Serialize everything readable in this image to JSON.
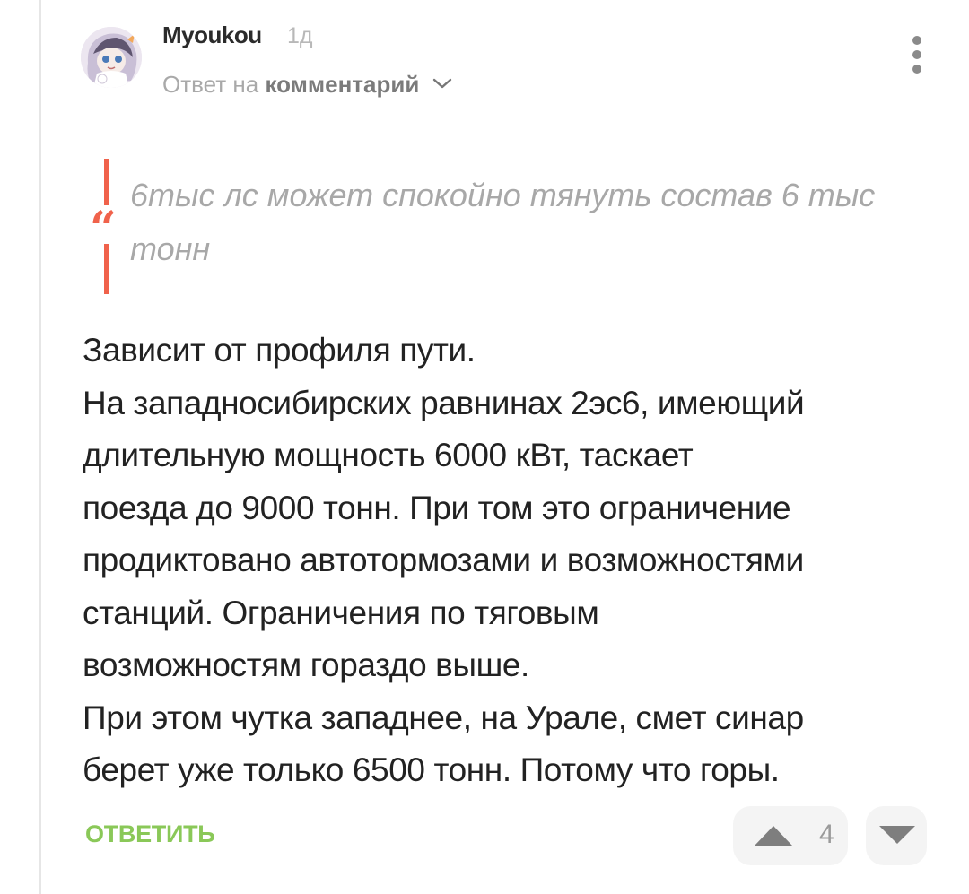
{
  "comment": {
    "author": "Myoukou",
    "time": "1д",
    "reply_to_prefix": "Ответ на ",
    "reply_to_link": "комментарий",
    "quote": "6тыс лс может спокойно тянуть состав 6 тыс тонн",
    "body_lines": [
      "Зависит от профиля пути.",
      "На западносибирских равнинах 2эс6, имеющий",
      "длительную мощность 6000 кВт, таскает",
      "поезда до 9000 тонн. При том это ограничение",
      "продиктовано автотормозами и возможностями",
      "станций. Ограничения по тяговым",
      "возможностям гораздо выше.",
      "При этом чутка западнее, на Урале, смет синар",
      "берет уже только 6500 тонн. Потому что горы."
    ],
    "reply_label": "ОТВЕТИТЬ",
    "rating": "4"
  },
  "icons": {
    "avatar": "anime-avatar",
    "menu": "more-vertical-icon",
    "reply_chevron": "chevron-down-icon",
    "quote": "quote-icon",
    "upvote": "triangle-up-icon",
    "downvote": "triangle-down-icon"
  },
  "colors": {
    "accent_quote": "#f0624b",
    "reply_button": "#8ac858",
    "vote_bg": "#f4f4f4"
  }
}
